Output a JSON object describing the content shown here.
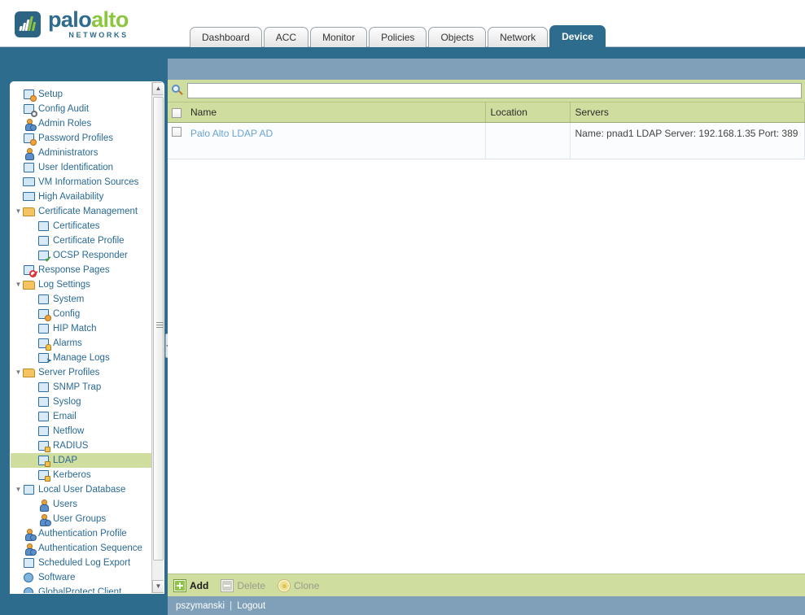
{
  "brand": {
    "name_part1": "palo",
    "name_part2": "alto",
    "subtitle": "NETWORKS",
    "logo_color": "#2d6383",
    "accent_green": "#8cc63e",
    "accent_blue": "#2e6c8e"
  },
  "tabs": [
    {
      "label": "Dashboard",
      "active": false
    },
    {
      "label": "ACC",
      "active": false
    },
    {
      "label": "Monitor",
      "active": false
    },
    {
      "label": "Policies",
      "active": false
    },
    {
      "label": "Objects",
      "active": false
    },
    {
      "label": "Network",
      "active": false
    },
    {
      "label": "Device",
      "active": true
    }
  ],
  "sidebar": {
    "selected": "LDAP",
    "selected_color": "#cfdd9e",
    "items": [
      {
        "label": "Setup",
        "indent": 0,
        "twisty": "",
        "icon": "setup-icon"
      },
      {
        "label": "Config Audit",
        "indent": 0,
        "twisty": "",
        "icon": "config-audit-icon"
      },
      {
        "label": "Admin Roles",
        "indent": 0,
        "twisty": "",
        "icon": "admin-roles-icon"
      },
      {
        "label": "Password Profiles",
        "indent": 0,
        "twisty": "",
        "icon": "password-profiles-icon"
      },
      {
        "label": "Administrators",
        "indent": 0,
        "twisty": "",
        "icon": "administrators-icon"
      },
      {
        "label": "User Identification",
        "indent": 0,
        "twisty": "",
        "icon": "user-identification-icon"
      },
      {
        "label": "VM Information Sources",
        "indent": 0,
        "twisty": "",
        "icon": "vm-information-sources-icon"
      },
      {
        "label": "High Availability",
        "indent": 0,
        "twisty": "",
        "icon": "high-availability-icon"
      },
      {
        "label": "Certificate Management",
        "indent": 0,
        "twisty": "▼",
        "icon": "certificate-management-folder-icon"
      },
      {
        "label": "Certificates",
        "indent": 1,
        "twisty": "",
        "icon": "certificates-icon"
      },
      {
        "label": "Certificate Profile",
        "indent": 1,
        "twisty": "",
        "icon": "certificate-profile-icon"
      },
      {
        "label": "OCSP Responder",
        "indent": 1,
        "twisty": "",
        "icon": "ocsp-responder-icon"
      },
      {
        "label": "Response Pages",
        "indent": 0,
        "twisty": "",
        "icon": "response-pages-icon"
      },
      {
        "label": "Log Settings",
        "indent": 0,
        "twisty": "▼",
        "icon": "log-settings-folder-icon"
      },
      {
        "label": "System",
        "indent": 1,
        "twisty": "",
        "icon": "system-log-icon"
      },
      {
        "label": "Config",
        "indent": 1,
        "twisty": "",
        "icon": "config-log-icon"
      },
      {
        "label": "HIP Match",
        "indent": 1,
        "twisty": "",
        "icon": "hip-match-icon"
      },
      {
        "label": "Alarms",
        "indent": 1,
        "twisty": "",
        "icon": "alarms-icon"
      },
      {
        "label": "Manage Logs",
        "indent": 1,
        "twisty": "",
        "icon": "manage-logs-icon"
      },
      {
        "label": "Server Profiles",
        "indent": 0,
        "twisty": "▼",
        "icon": "server-profiles-folder-icon"
      },
      {
        "label": "SNMP Trap",
        "indent": 1,
        "twisty": "",
        "icon": "snmp-trap-icon"
      },
      {
        "label": "Syslog",
        "indent": 1,
        "twisty": "",
        "icon": "syslog-icon"
      },
      {
        "label": "Email",
        "indent": 1,
        "twisty": "",
        "icon": "email-icon"
      },
      {
        "label": "Netflow",
        "indent": 1,
        "twisty": "",
        "icon": "netflow-icon"
      },
      {
        "label": "RADIUS",
        "indent": 1,
        "twisty": "",
        "icon": "radius-icon"
      },
      {
        "label": "LDAP",
        "indent": 1,
        "twisty": "",
        "icon": "ldap-icon"
      },
      {
        "label": "Kerberos",
        "indent": 1,
        "twisty": "",
        "icon": "kerberos-icon"
      },
      {
        "label": "Local User Database",
        "indent": 0,
        "twisty": "▼",
        "icon": "local-user-database-icon"
      },
      {
        "label": "Users",
        "indent": 1,
        "twisty": "",
        "icon": "users-icon"
      },
      {
        "label": "User Groups",
        "indent": 1,
        "twisty": "",
        "icon": "user-groups-icon"
      },
      {
        "label": "Authentication Profile",
        "indent": 0,
        "twisty": "",
        "icon": "authentication-profile-icon"
      },
      {
        "label": "Authentication Sequence",
        "indent": 0,
        "twisty": "",
        "icon": "authentication-sequence-icon"
      },
      {
        "label": "Scheduled Log Export",
        "indent": 0,
        "twisty": "",
        "icon": "scheduled-log-export-icon"
      },
      {
        "label": "Software",
        "indent": 0,
        "twisty": "",
        "icon": "software-icon"
      },
      {
        "label": "GlobalProtect Client",
        "indent": 0,
        "twisty": "",
        "icon": "globalprotect-client-icon"
      }
    ]
  },
  "search": {
    "value": "",
    "placeholder": ""
  },
  "table": {
    "columns": [
      "Name",
      "Location",
      "Servers"
    ],
    "rows": [
      {
        "name": "Palo Alto LDAP AD",
        "location": "",
        "servers": "Name: pnad1 LDAP Server: 192.168.1.35 Port: 389"
      }
    ]
  },
  "toolbar": {
    "add_label": "Add",
    "delete_label": "Delete",
    "clone_label": "Clone"
  },
  "statusbar": {
    "user": "pszymanski",
    "separator": "|",
    "logout_label": "Logout"
  }
}
